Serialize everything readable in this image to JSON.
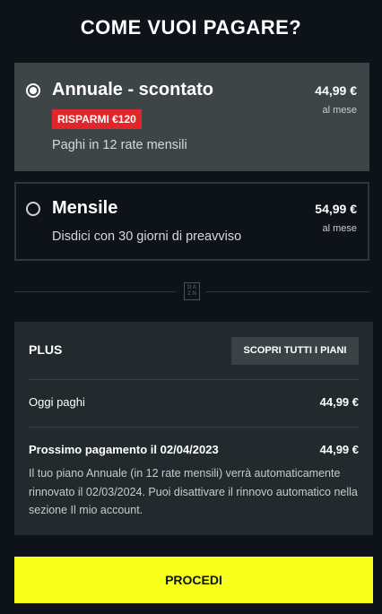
{
  "header": {
    "title": "COME VUOI PAGARE?"
  },
  "plans": [
    {
      "name": "Annuale - scontato",
      "badge": "RISPARMI €120",
      "description": "Paghi in 12 rate mensili",
      "price": "44,99 €",
      "period": "al mese",
      "selected": true
    },
    {
      "name": "Mensile",
      "description": "Disdici con 30 giorni di preavviso",
      "price": "54,99 €",
      "period": "al mese",
      "selected": false
    }
  ],
  "divider": {
    "logo_icon": "dazn-logo-icon",
    "logo_text": "DAZN"
  },
  "summary": {
    "plan_label": "PLUS",
    "all_plans_button": "SCOPRI TUTTI I PIANI",
    "today_label": "Oggi paghi",
    "today_value": "44,99 €",
    "next_label": "Prossimo pagamento il 02/04/2023",
    "next_value": "44,99 €",
    "note": "Il tuo piano Annuale (in 12 rate mensili) verrà automaticamente rinnovato il 02/03/2024. Puoi disattivare il rinnovo automatico nella sezione Il mio account."
  },
  "cta": {
    "label": "PROCEDI"
  },
  "colors": {
    "background": "#0d1318",
    "selected_card": "#3e4547",
    "badge": "#e1252b",
    "summary_panel": "#232a2e",
    "cta": "#f7ff1a"
  }
}
